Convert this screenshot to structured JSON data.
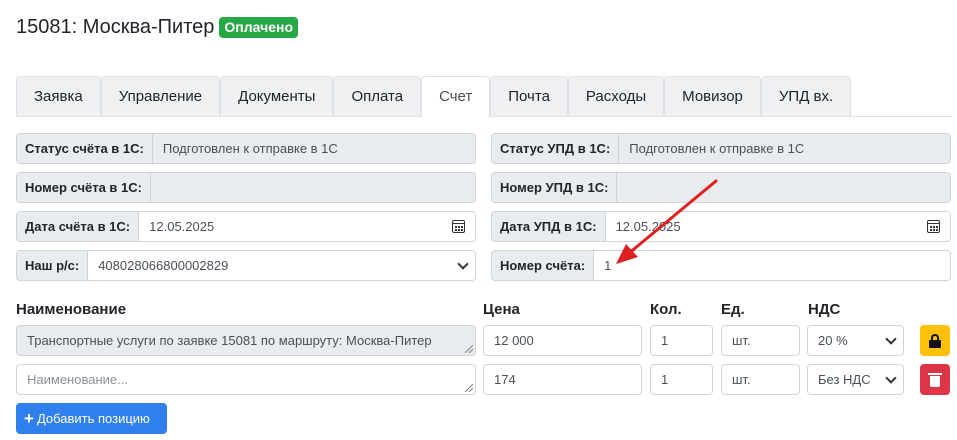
{
  "header": {
    "title": "15081: Москва-Питер",
    "badge": "Оплачено"
  },
  "tabs": [
    "Заявка",
    "Управление",
    "Документы",
    "Оплата",
    "Счет",
    "Почта",
    "Расходы",
    "Мовизор",
    "УПД вх."
  ],
  "active_tab": "Счет",
  "left_fields": {
    "invoice_status": {
      "label": "Статус счёта в 1С:",
      "value": "Подготовлен к отправке в 1С"
    },
    "invoice_number": {
      "label": "Номер счёта в 1С:",
      "value": ""
    },
    "invoice_date": {
      "label": "Дата счёта в 1С:",
      "value": "12.05.2025"
    },
    "account": {
      "label": "Наш р/с:",
      "value": "40802806680000282­9"
    }
  },
  "right_fields": {
    "upd_status": {
      "label": "Статус УПД в 1С:",
      "value": "Подготовлен к отправке в 1С"
    },
    "upd_number": {
      "label": "Номер УПД в 1С:",
      "value": ""
    },
    "upd_date": {
      "label": "Дата УПД в 1С:",
      "value": "12.05.2025"
    },
    "invoice_num": {
      "label": "Номер счёта:",
      "value": "1"
    }
  },
  "columns": {
    "name": "Наименование",
    "price": "Цена",
    "qty": "Кол.",
    "unit": "Ед.",
    "vat": "НДС"
  },
  "rows": [
    {
      "name": "Транспортные услуги по заявке 15081 по маршруту: Москва-Питер",
      "price": "12 000",
      "qty": "1",
      "unit": "шт.",
      "vat": "20 %"
    },
    {
      "name": "",
      "price": "174",
      "qty": "1",
      "unit": "шт.",
      "vat": "Без НДС"
    }
  ],
  "name_placeholder": "Наименование...",
  "add_button": "Добавить позицию",
  "icons": {
    "lock": "lock-icon",
    "trash": "trash-icon",
    "calendar": "calendar-icon",
    "plus": "plus-icon"
  },
  "colors": {
    "badge": "#28a745",
    "lock_btn": "#ffc107",
    "trash_btn": "#dc3545",
    "add_btn": "#2f80ed",
    "arrow": "#e02020"
  }
}
